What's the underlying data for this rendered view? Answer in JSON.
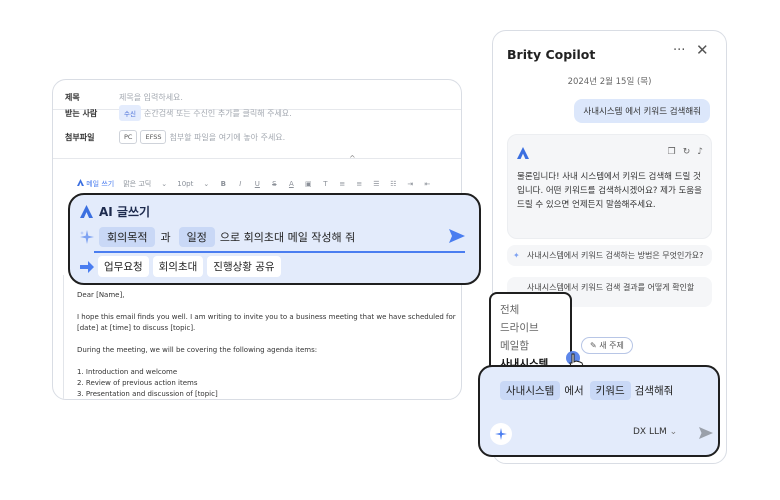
{
  "email": {
    "subject_label": "제목",
    "subject_placeholder": "제목을 입력하세요.",
    "recipient_label": "받는 사람",
    "recipient_chip": "수신",
    "recipient_placeholder": "순간검색 또는 수신인 추가를 클릭해 주세요.",
    "attach_label": "첨부파일",
    "attach_pc": "PC",
    "attach_efss": "EFSS",
    "attach_placeholder": "첨부할 파일을 여기에 놓아 주세요.",
    "toolbar": {
      "ai_write": "메일 쓰기",
      "font": "맑은 고딕",
      "size": "10pt"
    },
    "body": {
      "greeting": "Dear [Name],",
      "para1": "I hope this email finds you well. I am writing to invite you to a business meeting that we have scheduled for [date] at [time] to discuss [topic].",
      "para2": "During the meeting, we will be covering the following agenda items:",
      "item1": "1. Introduction and welcome",
      "item2": "2. Review of previous action items",
      "item3": "3. Presentation and discussion of [topic]"
    }
  },
  "ai_popup": {
    "title": "AI 글쓰기",
    "kw1": "회의목적",
    "conj": "과",
    "kw2": "일정",
    "tail": "으로 회의초대 메일 작성해 줘",
    "suggestions": [
      "업무요청",
      "회의초대",
      "진행상황 공유"
    ]
  },
  "copilot": {
    "title": "Brity Copilot",
    "more": "···",
    "close": "✕",
    "date": "2024년 2월 15일 (목)",
    "user_msg": "사내시스템 에서 키워드 검색해줘",
    "bot_msg": "물론입니다! 사내 시스템에서 키워드 검색해 드릴 것입니다. 어떤 키워드를 검색하시겠어요? 제가 도움을 드릴 수 있으면 언제든지 말씀해주세요.",
    "q1": "사내시스템에서 키워드 검색하는 방법은 무엇인가요?",
    "q2": "사내시스템에서 키워드 검색 결과를 어떻게 확인할 수",
    "new_topic": "새 주제",
    "dropdown": [
      "전체",
      "드라이브",
      "메일함",
      "사내시스템"
    ],
    "input": {
      "kw1": "사내시스템",
      "mid": "에서",
      "kw2": "키워드",
      "tail": "검색해줘"
    },
    "model": "DX LLM",
    "accent": "#4a7df0"
  }
}
